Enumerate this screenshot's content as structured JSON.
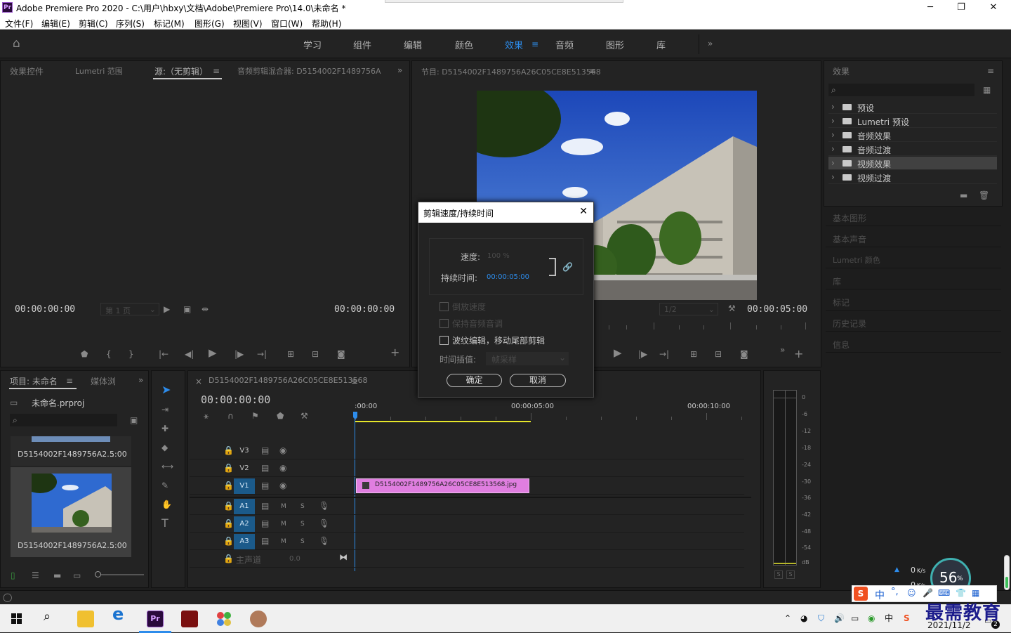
{
  "window": {
    "title": "Adobe Premiere Pro 2020 - C:\\用户\\hbxy\\文档\\Adobe\\Premiere Pro\\14.0\\未命名 *",
    "app_icon": "Pr",
    "minimize": "─",
    "maximize": "❐",
    "close": "✕"
  },
  "menu": [
    "文件(F)",
    "编辑(E)",
    "剪辑(C)",
    "序列(S)",
    "标记(M)",
    "图形(G)",
    "视图(V)",
    "窗口(W)",
    "帮助(H)"
  ],
  "workspaces": [
    "学习",
    "组件",
    "编辑",
    "颜色",
    "效果",
    "音频",
    "图形",
    "库"
  ],
  "workspace_active": "效果",
  "source_panel": {
    "tabs": [
      "效果控件",
      "Lumetri 范围",
      "源:（无剪辑）",
      "音频剪辑混合器: D5154002F1489756A"
    ],
    "tc_left": "00:00:00:00",
    "page": "第 1 页",
    "tc_right": "00:00:00:00"
  },
  "program_panel": {
    "title": "节目: D5154002F1489756A26C05CE8E513568",
    "resolution": "1/2",
    "timecode": "00:00:05:00"
  },
  "effects_panel": {
    "title": "效果",
    "items": [
      "预设",
      "Lumetri 预设",
      "音频效果",
      "音频过渡",
      "视频效果",
      "视频过渡"
    ],
    "selected_index": 4,
    "sections": [
      "基本图形",
      "基本声音",
      "Lumetri 颜色",
      "库",
      "标记",
      "历史记录",
      "信息"
    ]
  },
  "project_panel": {
    "tabs": [
      "项目: 未命名",
      "媒体浏"
    ],
    "project_file": "未命名.prproj",
    "clips": [
      {
        "name": "D5154002F1489756A2...",
        "duration": "5:00"
      },
      {
        "name": "D5154002F1489756A2...",
        "duration": "5:00"
      }
    ]
  },
  "timeline": {
    "tab": "D5154002F1489756A26C05CE8E513568",
    "timecode": "00:00:00:00",
    "ruler": [
      ":00:00",
      "00:00:05:00",
      "00:00:10:00"
    ],
    "video_tracks": [
      "V3",
      "V2",
      "V1"
    ],
    "audio_tracks": [
      "A1",
      "A2",
      "A3"
    ],
    "audio_flags": [
      "M",
      "S"
    ],
    "master": "主声道",
    "master_value": "0.0",
    "clip_name": "D5154002F1489756A26C05CE8E513568.jpg"
  },
  "meter": {
    "scale": [
      "0",
      "-6",
      "-12",
      "-18",
      "-24",
      "-30",
      "-36",
      "-42",
      "-48",
      "-54",
      "dB"
    ],
    "solo": "S"
  },
  "dialog": {
    "title": "剪辑速度/持续时间",
    "speed_label": "速度:",
    "speed_value": "100 %",
    "duration_label": "持续时间:",
    "duration_value": "00:00:05:00",
    "options": [
      {
        "label": "倒放速度",
        "checked": false,
        "enabled": false
      },
      {
        "label": "保持音频音调",
        "checked": false,
        "enabled": false
      },
      {
        "label": "波纹编辑，移动尾部剪辑",
        "checked": false,
        "enabled": true
      }
    ],
    "interp_label": "时间插值:",
    "interp_value": "帧采样",
    "ok": "确定",
    "cancel": "取消"
  },
  "net_widget": {
    "up": "0",
    "up_unit": "K/s",
    "down": "0",
    "down_unit": "K/s",
    "percent": "56",
    "percent_unit": "%"
  },
  "ime_bar": {
    "chars": [
      "中",
      "°,"
    ]
  },
  "watermark": "最需教育",
  "taskbar": {
    "date": "2021/11/2",
    "notif_count": "2"
  },
  "colors": {
    "accent": "#2d8ceb",
    "clip": "#e07ee0",
    "track_on": "#1b5a8a",
    "yellow": "#e6e62a"
  }
}
